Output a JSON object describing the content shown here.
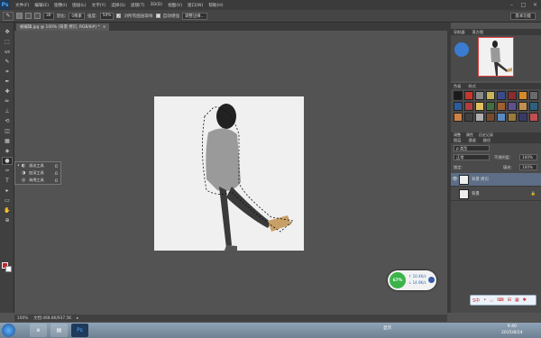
{
  "app": {
    "logo": "Ps"
  },
  "menu": [
    "文件(F)",
    "编辑(E)",
    "图像(I)",
    "图层(L)",
    "文字(Y)",
    "选择(S)",
    "滤镜(T)",
    "3D(D)",
    "视图(V)",
    "窗口(W)",
    "帮助(H)"
  ],
  "window_controls": [
    "–",
    "□",
    "×"
  ],
  "options": {
    "tool_icon": "quick-selection-icon",
    "brush_size": "30",
    "mode_label": "羽化:",
    "mode_value": "0像素",
    "opacity_label": "强度:",
    "opacity_value": "50%",
    "sample_label": "对所有图层取样",
    "auto_enhance": "自动增强",
    "refine": "调整边缘...",
    "workspace": "基本功能"
  },
  "document_tab": {
    "title": "被编辑.jpg @ 100% (背景 拷贝, RGB/8#) *",
    "close": "×"
  },
  "tools": [
    "move-icon",
    "marquee-icon",
    "lasso-icon",
    "quick-selection-icon",
    "crop-icon",
    "eyedropper-icon",
    "healing-icon",
    "brush-icon",
    "clone-stamp-icon",
    "history-brush-icon",
    "eraser-icon",
    "gradient-icon",
    "blur-icon",
    "dodge-icon",
    "pen-icon",
    "type-icon",
    "path-selection-icon",
    "shape-icon",
    "hand-icon",
    "zoom-icon"
  ],
  "tool_glyphs": [
    "✥",
    "⬚",
    "ᔕ",
    "✎",
    "⌗",
    "✒",
    "✚",
    "✏",
    "⊥",
    "⟲",
    "◫",
    "▦",
    "◈",
    "●",
    "✑",
    "T",
    "▸",
    "▭",
    "✋",
    "⊕"
  ],
  "flyout": [
    {
      "label": "减淡工具",
      "key": "O"
    },
    {
      "label": "加深工具",
      "key": "O"
    },
    {
      "label": "海绵工具",
      "key": "O"
    }
  ],
  "status": {
    "zoom": "100%",
    "doc": "文档:468.8K/937.5K",
    "arrow": "▸"
  },
  "network": {
    "percent": "67%",
    "up": "↑ 10.4K/s",
    "down": "↓ 14.9K/s"
  },
  "panels": {
    "navigator_tabs": [
      "导航器",
      "直方图"
    ],
    "styles_tabs": [
      "色板",
      "样式"
    ],
    "adjust_tabs": [
      "调整",
      "属性",
      "历史记录"
    ],
    "layers_tabs": [
      "图层",
      "通道",
      "路径"
    ],
    "blend_mode": "正常",
    "opacity_label": "不透明度:",
    "opacity": "100%",
    "lock_label": "锁定:",
    "fill_label": "填充:",
    "fill": "100%",
    "kind_label": "ρ 类型",
    "layers": [
      {
        "name": "背景 拷贝",
        "selected": true,
        "visible": true
      },
      {
        "name": "背景",
        "selected": false,
        "visible": false
      }
    ],
    "style_colors": [
      "#1a1a1a",
      "#c7362c",
      "#8a8a8a",
      "#c8b45a",
      "#3d4a8a",
      "#8c2b2b",
      "#d48a2a",
      "#6a6a6a",
      "#2c5c9a",
      "#b04040",
      "#e0c060",
      "#407040",
      "#a06030",
      "#605090",
      "#c09050",
      "#306080",
      "#d08040",
      "#404040",
      "#b0b0b0",
      "#7a4a2a",
      "#5a8ac0",
      "#9a7a3a",
      "#3a3a6a",
      "#c05050"
    ]
  },
  "ime": {
    "label": "S中",
    "items": [
      "•",
      "◡",
      "⌨",
      "⊞",
      "▦",
      "✱"
    ]
  },
  "taskbar": {
    "apps": [
      "e",
      "▤",
      "Ps"
    ]
  },
  "tray": {
    "text": "显示"
  },
  "clock": {
    "time": "9:40",
    "date": "2015/8/24"
  }
}
